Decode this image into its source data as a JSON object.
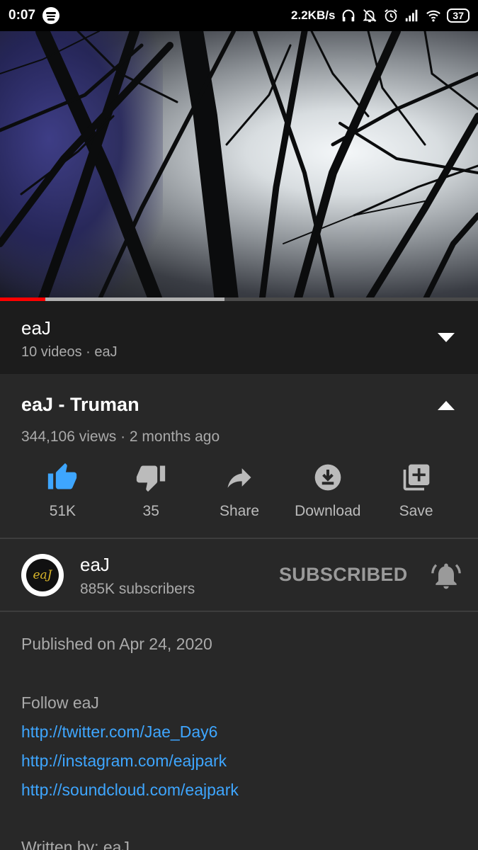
{
  "status_bar": {
    "time": "0:07",
    "network_speed": "2.2KB/s",
    "battery": "37",
    "icons": [
      "spotify-icon",
      "headphones-icon",
      "bell-off-icon",
      "alarm-icon",
      "signal-icon",
      "wifi-icon",
      "battery-icon"
    ]
  },
  "player": {
    "progress_fraction": 0.095,
    "buffered_fraction": 0.47,
    "colors": {
      "played": "#ff0000",
      "buffered": "#b0b0b0"
    }
  },
  "playlist": {
    "title": "eaJ",
    "subtitle": "10 videos · eaJ"
  },
  "video": {
    "title": "eaJ - Truman",
    "meta": "344,106 views · 2 months ago"
  },
  "actions": [
    {
      "label": "51K",
      "icon": "thumbs-up-icon",
      "active": true
    },
    {
      "label": "35",
      "icon": "thumbs-down-icon",
      "active": false
    },
    {
      "label": "Share",
      "icon": "share-icon",
      "active": false
    },
    {
      "label": "Download",
      "icon": "download-icon",
      "active": false
    },
    {
      "label": "Save",
      "icon": "add-to-playlist-icon",
      "active": false
    }
  ],
  "channel": {
    "name": "eaJ",
    "subscribers": "885K subscribers",
    "subscribe_label": "SUBSCRIBED",
    "avatar_text": "eaJ"
  },
  "description": {
    "published": "Published on Apr 24, 2020",
    "follow": "Follow eaJ",
    "links": [
      "http://twitter.com/Jae_Day6",
      "http://instagram.com/eajpark",
      "http://soundcloud.com/eajpark"
    ],
    "written_by": "Written by: eaJ"
  },
  "colors": {
    "accent_blue": "#3ea6ff",
    "like_active": "#3ea6ff",
    "background": "#282828"
  }
}
